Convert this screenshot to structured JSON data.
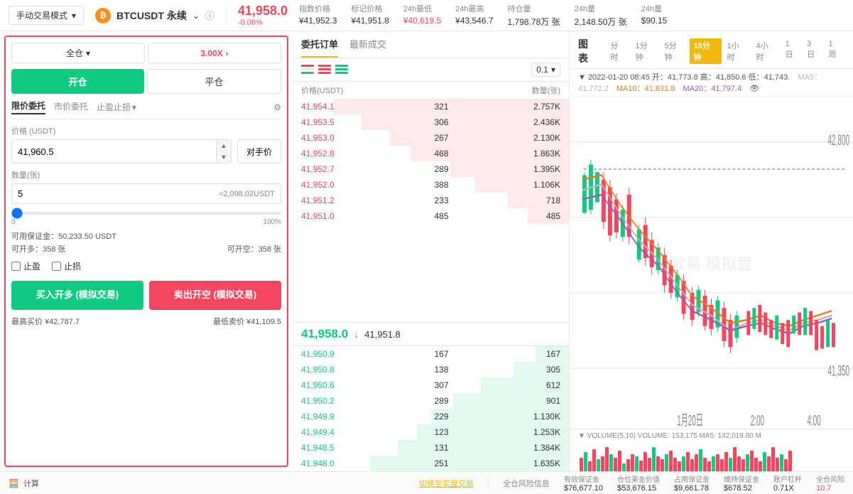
{
  "header": {
    "mode_label": "手动交易模式",
    "symbol": "BTCUSDT 永续",
    "info_icon": "ℹ",
    "price": "41,958.0",
    "price_change": "-0.06%",
    "index_price_label": "指数价格",
    "index_price": "¥41,952.3",
    "mark_price_label": "标记价格",
    "mark_price": "¥41,951.8",
    "low_24h_label": "24h最低",
    "low_24h": "¥40,619.5",
    "high_24h_label": "24h最高",
    "high_24h": "¥43,546.7",
    "oi_label": "持仓量",
    "oi": "1,798.78万 张",
    "vol_label": "24h量",
    "vol": "2,148.50万 张",
    "vol_usdt_label": "24h量",
    "vol_usdt": "$90.15"
  },
  "left": {
    "margin_type": "全仓",
    "leverage": "3.00X",
    "open_label": "开仓",
    "close_label": "平仓",
    "limit_label": "限价委托",
    "market_label": "市价委托",
    "stop_label": "止盈止损",
    "price_label": "价格 (USDT)",
    "price_value": "41,960.5",
    "counter_btn": "对手价",
    "qty_label": "数量(张)",
    "qty_value": "5",
    "qty_approx": "≈2,098.02USDT",
    "slider_min": "0",
    "slider_max": "100%",
    "available_label": "可用保证金：50,233.50 USDT",
    "open_long_label": "可开多：358 张",
    "open_short_label": "可开空：358 张",
    "tp_label": "止盈",
    "sl_label": "止损",
    "buy_btn": "买入开多 (模拟交易)",
    "sell_btn": "卖出开空 (模拟交易)",
    "max_buy": "最高买价 ¥42,787.7",
    "min_sell": "最低卖价 ¥41,109.5"
  },
  "orderbook": {
    "tab1": "委托订单",
    "tab2": "最新成交",
    "precision": "0.1",
    "col_price": "价格(USDT)",
    "col_qty": "数量(张)",
    "asks": [
      {
        "price": "41,954.1",
        "qty": "321",
        "total": "2.757K",
        "bg_pct": 85
      },
      {
        "price": "41,953.5",
        "qty": "306",
        "total": "2.436K",
        "bg_pct": 75
      },
      {
        "price": "41,953.0",
        "qty": "267",
        "total": "2.130K",
        "bg_pct": 65
      },
      {
        "price": "41,952.8",
        "qty": "468",
        "total": "1.863K",
        "bg_pct": 57
      },
      {
        "price": "41,952.7",
        "qty": "289",
        "total": "1.395K",
        "bg_pct": 43
      },
      {
        "price": "41,952.0",
        "qty": "388",
        "total": "1.106K",
        "bg_pct": 34
      },
      {
        "price": "41,951.2",
        "qty": "233",
        "total": "718",
        "bg_pct": 22
      },
      {
        "price": "41,951.0",
        "qty": "485",
        "total": "485",
        "bg_pct": 15
      }
    ],
    "mid_price": "41,958.0",
    "mid_arrow": "↓",
    "mid_ref": "41,951.8",
    "bids": [
      {
        "price": "41,950.9",
        "qty": "167",
        "total": "167",
        "bg_pct": 12
      },
      {
        "price": "41,950.8",
        "qty": "138",
        "total": "305",
        "bg_pct": 20
      },
      {
        "price": "41,950.6",
        "qty": "307",
        "total": "612",
        "bg_pct": 32
      },
      {
        "price": "41,950.2",
        "qty": "289",
        "total": "901",
        "bg_pct": 42
      },
      {
        "price": "41,949.9",
        "qty": "229",
        "total": "1.130K",
        "bg_pct": 50
      },
      {
        "price": "41,949.4",
        "qty": "123",
        "total": "1.253K",
        "bg_pct": 55
      },
      {
        "price": "41,948.5",
        "qty": "131",
        "total": "1.384K",
        "bg_pct": 62
      },
      {
        "price": "41,948.0",
        "qty": "251",
        "total": "1.635K",
        "bg_pct": 72
      }
    ]
  },
  "chart": {
    "title": "图表",
    "times": [
      "分时",
      "1分钟",
      "5分钟",
      "15分钟",
      "1小时",
      "4小时",
      "1日",
      "3日",
      "1周"
    ],
    "active_time": "15分钟",
    "info_line": "▼ 2022-01-20  08:45  开：41,773.8  高：41,850.6  低：41,743.",
    "ma5_label": "MA5：41,772.2",
    "ma10_label": "MA10：41,831.8",
    "ma20_label": "MA20：41,797.4",
    "eye_icon": "👁",
    "price_high": "42,800.0",
    "price_low": "41,350.0",
    "date_label": "1月20日",
    "time_2": "2:00",
    "time_4": "4:00",
    "watermark": "欧易 模拟盘",
    "volume_header": "▼ VOLUME(5,10)  VOLUME: 153,175  MA5: 142,019.80  M"
  },
  "bottom": {
    "risk_label": "全仓风险信息",
    "effective_margin_label": "有效保证金",
    "effective_margin": "$76,677.10",
    "position_value_label": "仓位美金价值",
    "position_value": "$53,676.15",
    "used_margin_label": "占用保证金",
    "used_margin": "$9,661.78",
    "maint_margin_label": "维持保证金",
    "maint_margin": "$678.52",
    "account_lever_label": "账户杠杆",
    "account_lever": "0.71X",
    "total_risk_label": "全仓风险",
    "total_risk": "10.7",
    "switch_live": "切换至实盘交易",
    "calc_label": "计算"
  }
}
